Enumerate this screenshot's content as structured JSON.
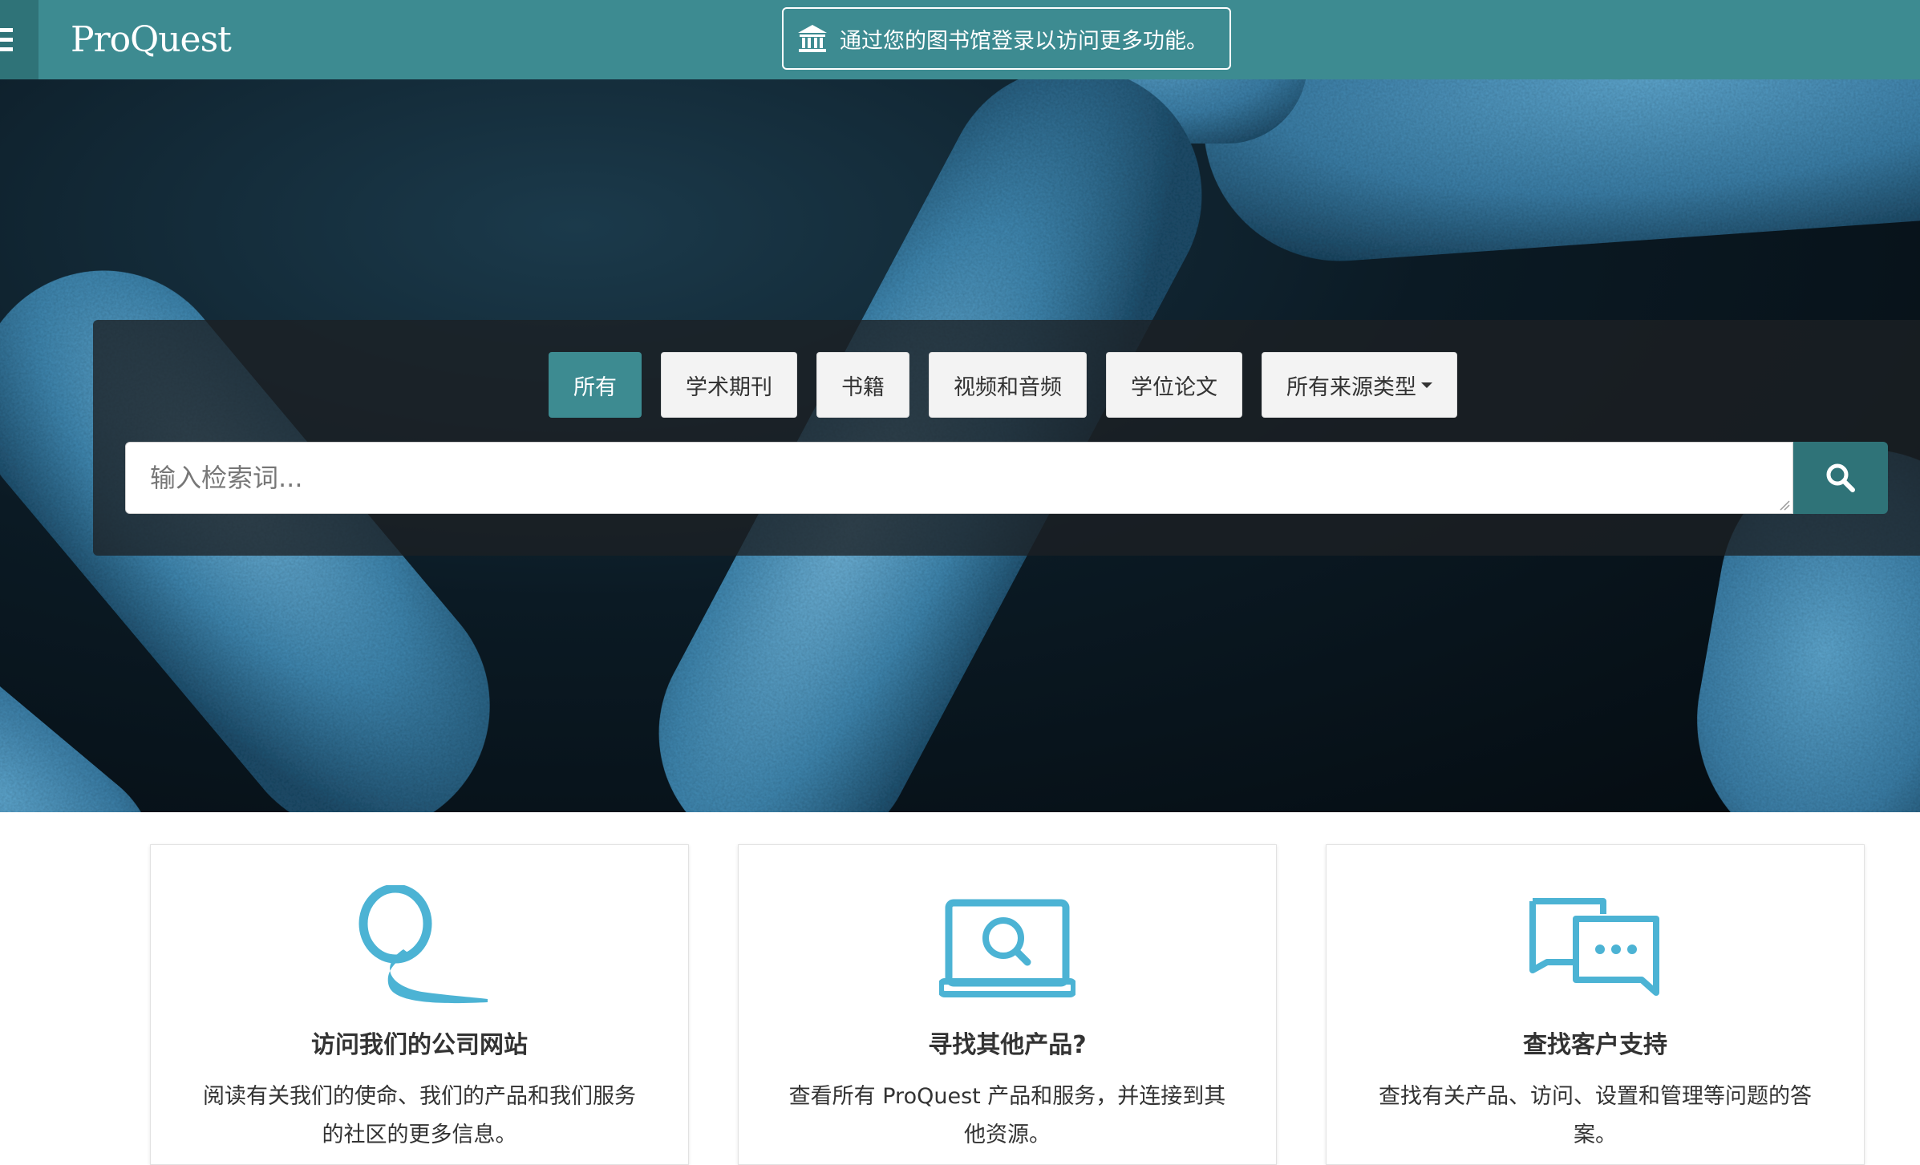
{
  "header": {
    "logo_text": "ProQuest",
    "login_banner": "通过您的图书馆登录以访问更多功能。",
    "brand_color": "#3d8b91"
  },
  "search": {
    "tabs": [
      {
        "label": "所有",
        "active": true
      },
      {
        "label": "学术期刊",
        "active": false
      },
      {
        "label": "书籍",
        "active": false
      },
      {
        "label": "视频和音频",
        "active": false
      },
      {
        "label": "学位论文",
        "active": false
      },
      {
        "label": "所有来源类型",
        "active": false
      }
    ],
    "placeholder": "输入检索词...",
    "button_icon": "search-icon"
  },
  "cards": [
    {
      "title": "访问我们的公司网站",
      "text": "阅读有关我们的使命、我们的产品和我们服务的社区的更多信息。",
      "icon": "proquest-q-icon"
    },
    {
      "title": "寻找其他产品?",
      "text": "查看所有 ProQuest 产品和服务，并连接到其他资源。",
      "icon": "laptop-search-icon"
    },
    {
      "title": "查找客户支持",
      "text": "查找有关产品、访问、设置和管理等问题的答案。",
      "icon": "chat-bubbles-icon"
    }
  ]
}
